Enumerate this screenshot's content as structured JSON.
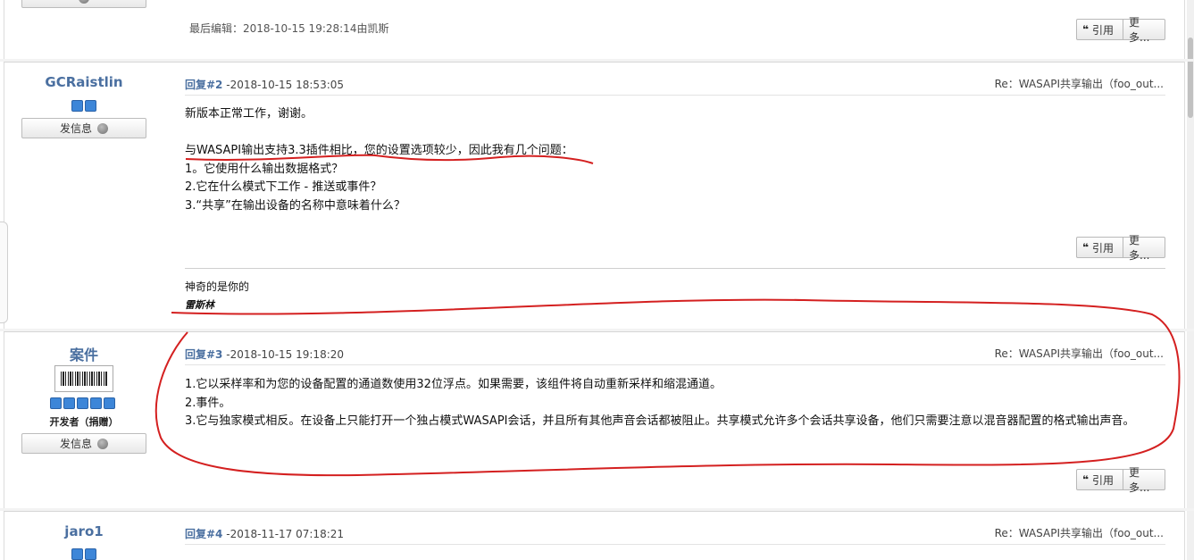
{
  "top_post": {
    "edit_note": "最后编辑：2018-10-15 19:28:14由凯斯",
    "quote_label": "引用",
    "more_label": "更多..."
  },
  "posts": [
    {
      "author": "GCRaistlin",
      "message_button": "发信息",
      "reply_label": "回复#2",
      "timestamp": "-2018-10-15 18:53:05",
      "subject": "Re：WASAPI共享输出（foo_out...",
      "lines": [
        "新版本正常工作，谢谢。",
        "",
        "与WASAPI输出支持3.3插件相比，您的设置选项较少，因此我有几个问题：",
        "1。它使用什么输出数据格式？",
        "2.它在什么模式下工作 - 推送或事件？",
        "3.“共享”在输出设备的名称中意味着什么？"
      ],
      "quote_label": "引用",
      "more_label": "更多...",
      "signature_line1": "神奇的是你的",
      "signature_line2": "雷斯林"
    },
    {
      "author": "案件",
      "user_title": "开发者（捐赠）",
      "message_button": "发信息",
      "reply_label": "回复#3",
      "timestamp": "-2018-10-15 19:18:20",
      "subject": "Re：WASAPI共享输出（foo_out...",
      "lines": [
        "1.它以采样率和为您的设备配置的通道数使用32位浮点。如果需要，该组件将自动重新采样和缩混通道。",
        "2.事件。",
        "3.它与独家模式相反。在设备上只能打开一个独占模式WASAPI会话，并且所有其他声音会话都被阻止。共享模式允许多个会话共享设备，他们只需要注意以混音器配置的格式输出声音。"
      ],
      "quote_label": "引用",
      "more_label": "更多..."
    },
    {
      "author": "jaro1",
      "reply_label": "回复#4",
      "timestamp": "-2018-11-17 07:18:21",
      "subject": "Re：WASAPI共享输出（foo_out..."
    }
  ],
  "colors": {
    "username": "#4a6fa0",
    "rank_badge": "#3d86d8",
    "annotation": "#d42020"
  },
  "icons": {
    "status": "offline-status-icon",
    "quote": "quote-icon"
  }
}
